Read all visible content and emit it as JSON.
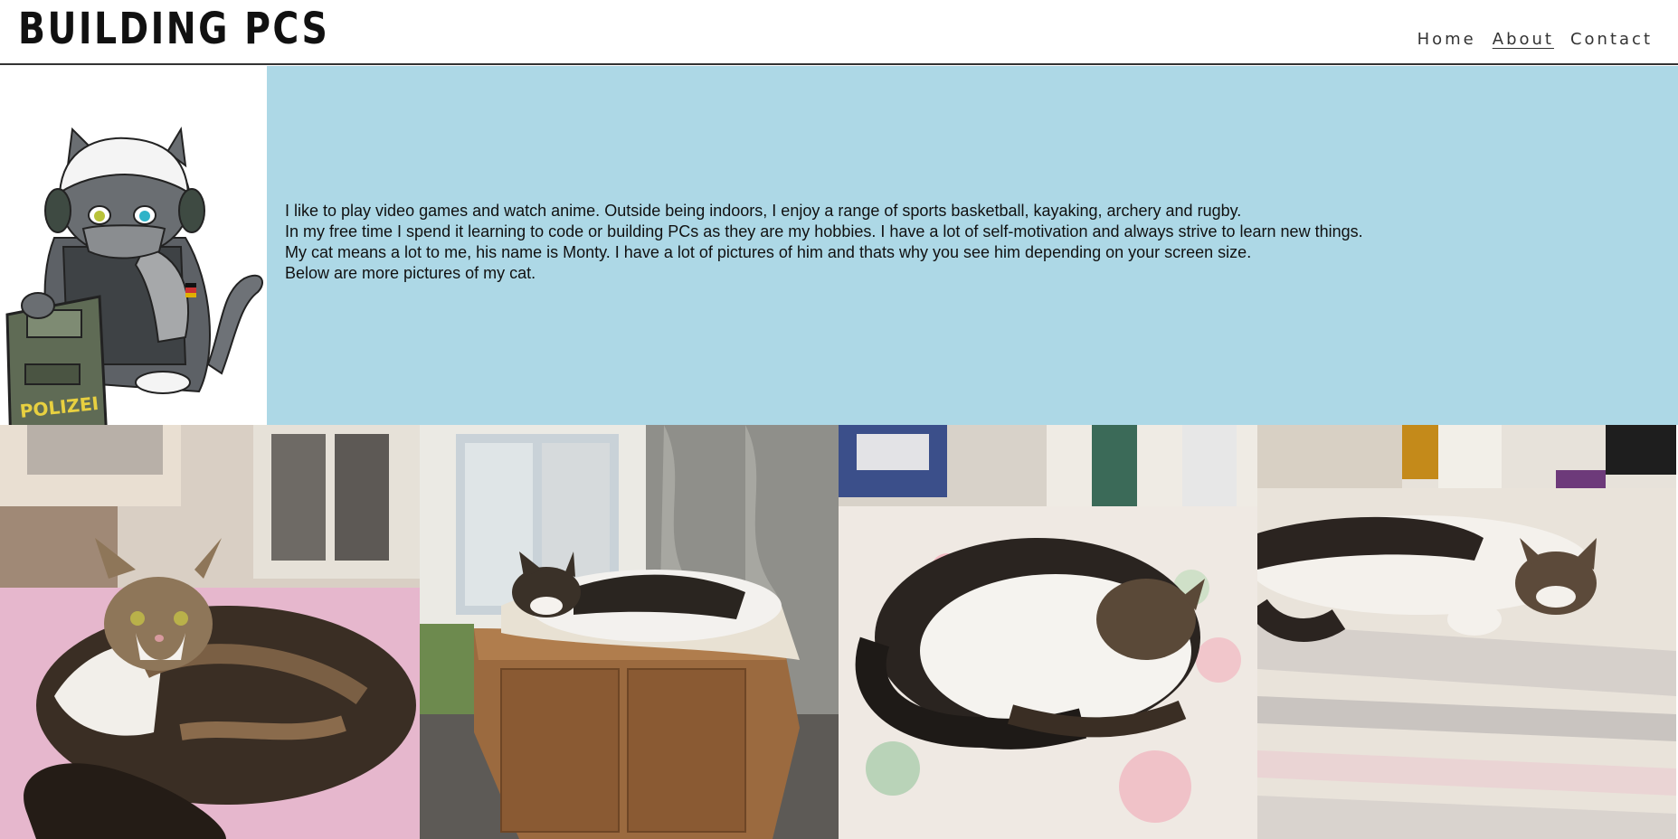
{
  "header": {
    "title": "BUILDING PCS",
    "nav": [
      {
        "label": "Home",
        "active": false
      },
      {
        "label": "About",
        "active": true
      },
      {
        "label": "Contact",
        "active": false
      }
    ]
  },
  "about": {
    "avatar_icon": "cat-soldier-illustration",
    "avatar_shield_text": "POLIZEI",
    "lines": [
      "I like to play video games and watch anime. Outside being indoors, I enjoy a range of sports basketball, kayaking, archery and rugby.",
      "In my free time I spend it learning to code or building PCs as they are my hobbies. I have a lot of self-motivation and always strive to learn new things.",
      "My cat means a lot to me, his name is Monty. I have a lot of pictures of him and thats why you see him depending on your screen size.",
      "Below are more pictures of my cat."
    ],
    "band_color": "#add8e6"
  },
  "gallery": {
    "photos": [
      {
        "icon": "cat-photo-on-pink-bed"
      },
      {
        "icon": "cat-photo-on-cabinet"
      },
      {
        "icon": "cat-photo-on-floral-bed"
      },
      {
        "icon": "cat-photo-on-striped-blanket"
      }
    ]
  }
}
